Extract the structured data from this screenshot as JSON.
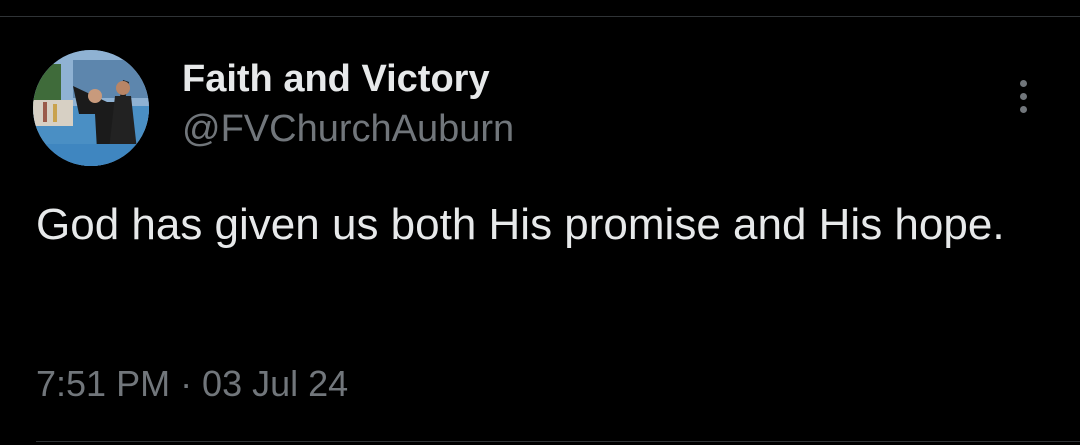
{
  "tweet": {
    "author": {
      "display_name": "Faith and Victory",
      "handle": "@FVChurchAuburn",
      "avatar_icon": "profile-photo"
    },
    "text": "God has given us both His promise and His hope.",
    "timestamp": "7:51 PM · 03 Jul 24",
    "more_icon": "more-options-icon"
  },
  "colors": {
    "background": "#000000",
    "primary_text": "#e7e9ea",
    "secondary_text": "#71767b",
    "divider": "#2f3336"
  }
}
